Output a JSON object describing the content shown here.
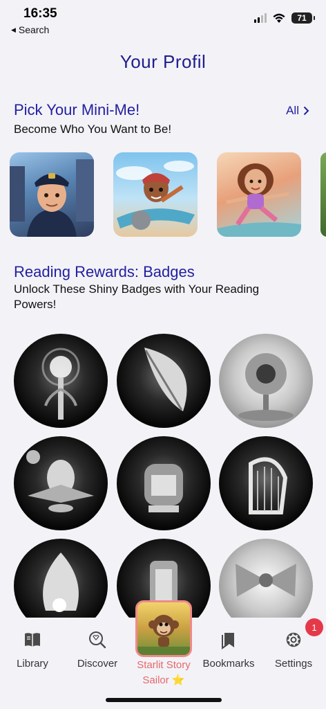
{
  "status": {
    "time": "16:35",
    "back_label": "Search",
    "battery": "71"
  },
  "page_title": "Your Profil",
  "mini_me": {
    "title": "Pick Your Mini-Me!",
    "subtitle": "Become Who You Want to Be!",
    "all_label": "All",
    "avatars": [
      {
        "name": "police-officer-avatar"
      },
      {
        "name": "pilot-avatar"
      },
      {
        "name": "skater-girl-avatar"
      }
    ]
  },
  "rewards": {
    "title": "Reading Rewards: Badges",
    "subtitle_line1": "Unlock These Shiny Badges with Your Reading",
    "subtitle_line2": "Powers!"
  },
  "nav": {
    "library": "Library",
    "discover": "Discover",
    "center_line1": "Starlit Story",
    "center_line2": "Sailor ⭐",
    "bookmarks": "Bookmarks",
    "settings": "Settings",
    "settings_badge": "1"
  },
  "colors": {
    "accent": "#2320a0",
    "center_label": "#e46a6a",
    "notification": "#e5394a"
  }
}
